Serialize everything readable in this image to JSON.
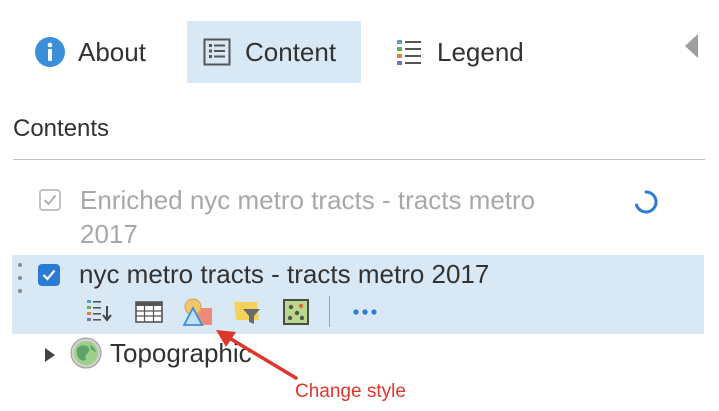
{
  "tabs": {
    "about": "About",
    "content": "Content",
    "legend": "Legend",
    "active": "content"
  },
  "heading": "Contents",
  "layers": [
    {
      "title": "Enriched nyc metro tracts - tracts metro 2017",
      "checked": true,
      "state": "loading"
    },
    {
      "title": "nyc metro tracts - tracts metro 2017",
      "checked": true,
      "state": "active",
      "tools": [
        "show-legend",
        "show-table",
        "change-style",
        "filter",
        "perform-analysis",
        "more-options"
      ]
    }
  ],
  "basemap": {
    "label": "Topographic",
    "expanded": false
  },
  "annotation": {
    "text": "Change style",
    "color": "#e0352b"
  },
  "colors": {
    "accent": "#2b7bd6",
    "selected_bg": "#d9e8f5",
    "info_blue": "#3a8fd9"
  }
}
